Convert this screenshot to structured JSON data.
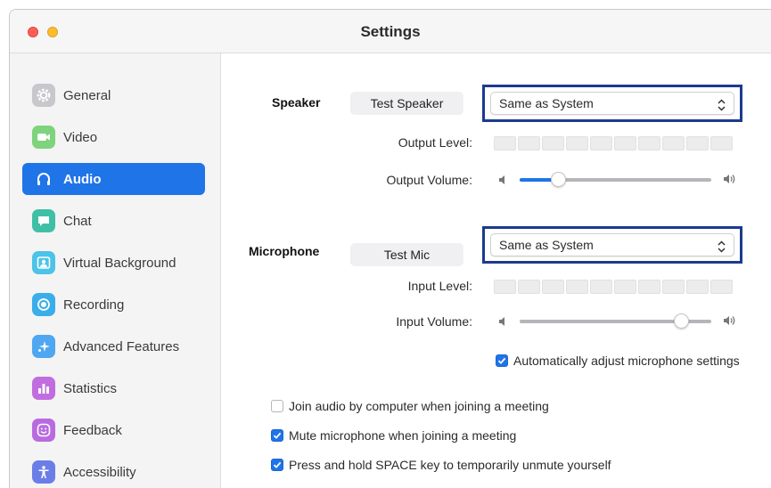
{
  "window": {
    "title": "Settings"
  },
  "sidebar": {
    "items": [
      {
        "label": "General",
        "icon": "gear-icon",
        "color": "#c7c7cc"
      },
      {
        "label": "Video",
        "icon": "video-camera-icon",
        "color": "#7ed37c"
      },
      {
        "label": "Audio",
        "icon": "headphones-icon",
        "color": "#1f74e8",
        "active": true
      },
      {
        "label": "Chat",
        "icon": "chat-bubble-icon",
        "color": "#3fc0a6"
      },
      {
        "label": "Virtual Background",
        "icon": "person-portrait-icon",
        "color": "#4cc3e8"
      },
      {
        "label": "Recording",
        "icon": "record-icon",
        "color": "#3aaeea"
      },
      {
        "label": "Advanced Features",
        "icon": "sparkle-icon",
        "color": "#4ea7f0"
      },
      {
        "label": "Statistics",
        "icon": "bar-chart-icon",
        "color": "#c16ddf"
      },
      {
        "label": "Feedback",
        "icon": "smiley-icon",
        "color": "#b86be0"
      },
      {
        "label": "Accessibility",
        "icon": "accessibility-person-icon",
        "color": "#6b7ee8"
      }
    ]
  },
  "speaker": {
    "section_label": "Speaker",
    "test_button": "Test Speaker",
    "device": "Same as System",
    "output_level_label": "Output Level:",
    "output_volume_label": "Output Volume:",
    "volume_fraction": 0.2
  },
  "microphone": {
    "section_label": "Microphone",
    "test_button": "Test Mic",
    "device": "Same as System",
    "input_level_label": "Input Level:",
    "input_volume_label": "Input Volume:",
    "volume_fraction": 0.84,
    "auto_adjust_label": "Automatically adjust microphone settings",
    "auto_adjust_checked": true
  },
  "options": [
    {
      "label": "Join audio by computer when joining a meeting",
      "checked": false
    },
    {
      "label": "Mute microphone when joining a meeting",
      "checked": true
    },
    {
      "label": "Press and hold SPACE key to temporarily unmute yourself",
      "checked": true
    }
  ],
  "colors": {
    "accent": "#1f74e8",
    "highlight_frame": "#1c3a8f"
  }
}
